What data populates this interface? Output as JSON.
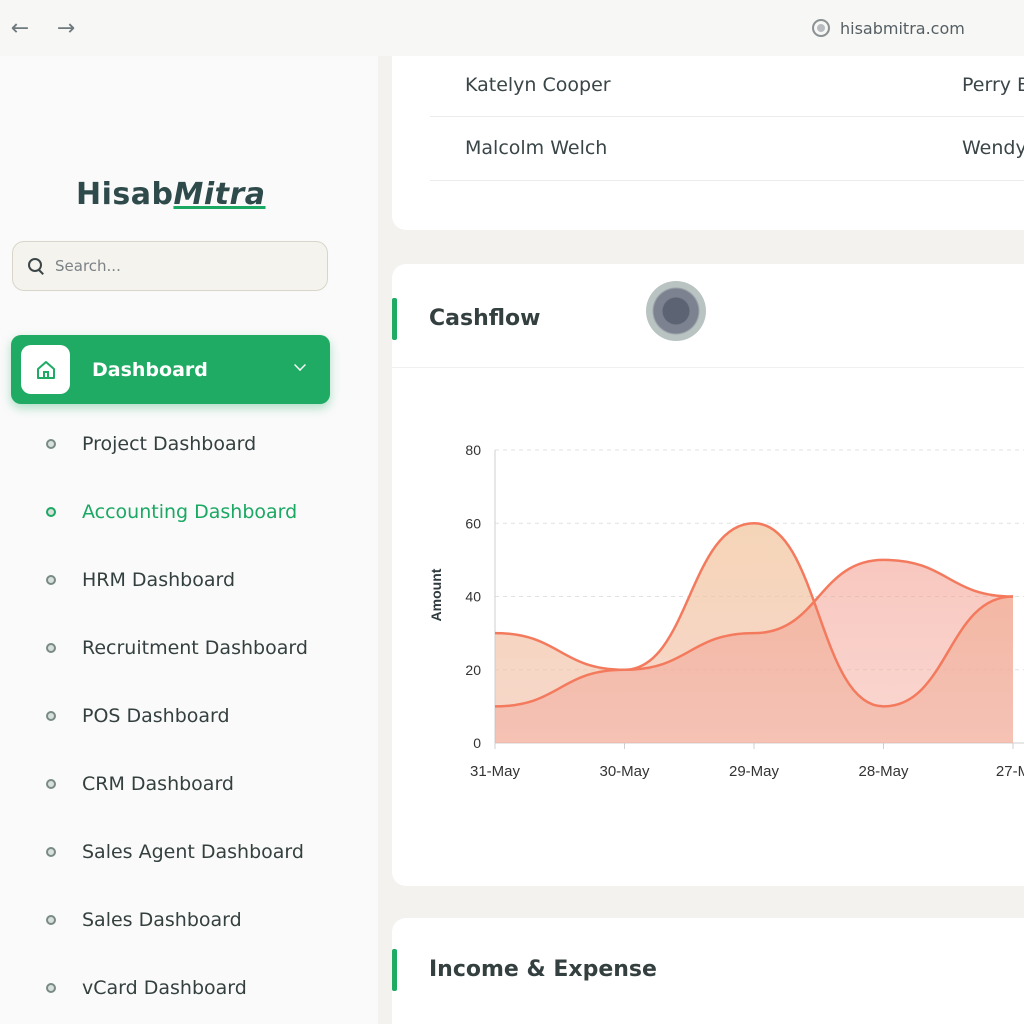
{
  "browser": {
    "url": "hisabmitra.com"
  },
  "logo": {
    "part1": "Hisab",
    "part2": "Mitra"
  },
  "search": {
    "placeholder": "Search..."
  },
  "sidebar": {
    "dashboard_label": "Dashboard",
    "items": [
      {
        "label": "Project Dashboard",
        "active": false
      },
      {
        "label": "Accounting Dashboard",
        "active": true
      },
      {
        "label": "HRM Dashboard",
        "active": false
      },
      {
        "label": "Recruitment Dashboard",
        "active": false
      },
      {
        "label": "POS Dashboard",
        "active": false
      },
      {
        "label": "CRM Dashboard",
        "active": false
      },
      {
        "label": "Sales Agent Dashboard",
        "active": false
      },
      {
        "label": "Sales Dashboard",
        "active": false
      },
      {
        "label": "vCard Dashboard",
        "active": false
      }
    ]
  },
  "top_table": {
    "rows": [
      {
        "col1": "Katelyn Cooper",
        "col2": "Perry E"
      },
      {
        "col1": "Malcolm Welch",
        "col2": "Wendy"
      }
    ]
  },
  "cashflow": {
    "title": "Cashflow"
  },
  "income_expense": {
    "title": "Income & Expense"
  },
  "colors": {
    "accent": "#1fab63",
    "series_line": "#f47a5e",
    "text_dark": "#34403f"
  },
  "chart_data": {
    "type": "area",
    "title": "",
    "xlabel": "",
    "ylabel": "Amount",
    "categories": [
      "31-May",
      "30-May",
      "29-May",
      "28-May",
      "27-M"
    ],
    "ylim": [
      0,
      80
    ],
    "yticks": [
      0,
      20,
      40,
      60,
      80
    ],
    "grid": true,
    "series": [
      {
        "values": [
          30,
          20,
          60,
          10,
          40
        ]
      },
      {
        "values": [
          10,
          20,
          30,
          50,
          40
        ]
      }
    ]
  }
}
